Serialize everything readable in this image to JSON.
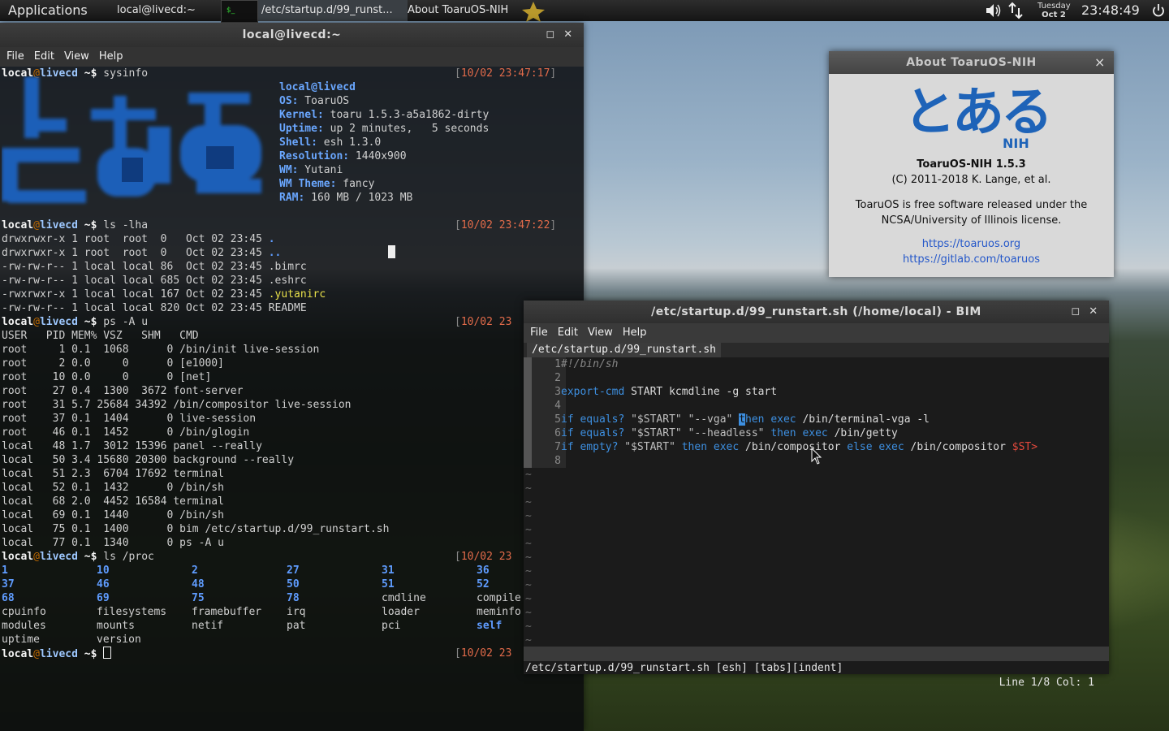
{
  "panel": {
    "apps": "Applications",
    "windows": [
      "local@livecd:~",
      "/etc/startup.d/99_runst...",
      "About ToaruOS-NIH"
    ],
    "thumb_text": "$_",
    "date_day": "Tuesday",
    "date_date": "Oct 2",
    "clock": "23:48:49",
    "volume_icon": "volume-icon",
    "network_icon": "network-icon",
    "power_icon": "power-icon"
  },
  "terminal": {
    "title": "local@livecd:~",
    "menu": [
      "File",
      "Edit",
      "View",
      "Help"
    ],
    "user": "local",
    "at": "@",
    "host": "livecd",
    "prompt": " ~$ ",
    "cmd1": "sysinfo",
    "ts1": "10/02 23:47:17",
    "sysinfo": [
      {
        "k": "",
        "v": "local@livecd"
      },
      {
        "k": "OS:",
        "v": " ToaruOS"
      },
      {
        "k": "Kernel:",
        "v": " toaru 1.5.3-a5a1862-dirty"
      },
      {
        "k": "Uptime:",
        "v": " up 2 minutes,   5 seconds"
      },
      {
        "k": "Shell:",
        "v": " esh 1.3.0"
      },
      {
        "k": "Resolution:",
        "v": " 1440x900"
      },
      {
        "k": "WM:",
        "v": " Yutani"
      },
      {
        "k": "WM Theme:",
        "v": " fancy"
      },
      {
        "k": "RAM:",
        "v": " 160 MB / 1023 MB"
      }
    ],
    "cmd2": "ls -lha",
    "ts2": "10/02 23:47:22",
    "ls_rows": [
      {
        "p": "drwxrwxr-x 1 root  root  0   Oct 02 23:45 ",
        "n": ".",
        "c": "bl"
      },
      {
        "p": "drwxrwxr-x 1 root  root  0   Oct 02 23:45 ",
        "n": "..",
        "c": "bl"
      },
      {
        "p": "-rw-rw-r-- 1 local local 86  Oct 02 23:45 ",
        "n": ".bimrc",
        "c": ""
      },
      {
        "p": "-rw-rw-r-- 1 local local 685 Oct 02 23:45 ",
        "n": ".eshrc",
        "c": ""
      },
      {
        "p": "-rwxrwxr-x 1 local local 167 Oct 02 23:45 ",
        "n": ".yutanirc",
        "c": "yl"
      },
      {
        "p": "-rw-rw-r-- 1 local local 820 Oct 02 23:45 ",
        "n": "README",
        "c": ""
      }
    ],
    "cmd3": "ps -A u",
    "ts3": "10/02 23",
    "ps_rows": [
      "USER   PID MEM% VSZ   SHM   CMD",
      "root     1 0.1  1068      0 /bin/init live-session",
      "root     2 0.0     0      0 [e1000]",
      "root    10 0.0     0      0 [net]",
      "root    27 0.4  1300  3672 font-server",
      "root    31 5.7 25684 34392 /bin/compositor live-session",
      "root    37 0.1  1404      0 live-session",
      "root    46 0.1  1452      0 /bin/glogin",
      "local   48 1.7  3012 15396 panel --really",
      "local   50 3.4 15680 20300 background --really",
      "local   51 2.3  6704 17692 terminal",
      "local   52 0.1  1432      0 /bin/sh",
      "local   68 2.0  4452 16584 terminal",
      "local   69 0.1  1440      0 /bin/sh",
      "local   75 0.1  1400      0 bim /etc/startup.d/99_runstart.sh",
      "local   77 0.1  1340      0 ps -A u"
    ],
    "cmd4": "ls /proc",
    "ts4": "10/02 23",
    "proc_rows": [
      [
        "1",
        "10",
        "2",
        "27",
        "31",
        "36"
      ],
      [
        "37",
        "46",
        "48",
        "50",
        "51",
        "52"
      ],
      [
        "68",
        "69",
        "75",
        "78",
        "cmdline",
        "compile"
      ],
      [
        "cpuinfo",
        "filesystems",
        "framebuffer",
        "irq",
        "loader",
        "meminfo"
      ],
      [
        "modules",
        "mounts",
        "netif",
        "pat",
        "pci",
        "self"
      ],
      [
        "uptime",
        "version",
        "",
        "",
        "",
        ""
      ]
    ],
    "ts5": "10/02 23"
  },
  "about": {
    "title": "About ToaruOS-NIH",
    "logo_text": "とある",
    "logo_sub": "NIH",
    "name": "ToaruOS-NIH 1.5.3",
    "copyright": "(C) 2011-2018 K. Lange, et al.",
    "desc1": "ToaruOS is free software released under the",
    "desc2": "NCSA/University of Illinois license.",
    "link1": "https://toaruos.org",
    "link2": "https://gitlab.com/toaruos",
    "close_icon": "×"
  },
  "bim": {
    "title": "/etc/startup.d/99_runstart.sh (/home/local) - BIM",
    "menu": [
      "File",
      "Edit",
      "View",
      "Help"
    ],
    "tab": "/etc/startup.d/99_runstart.sh",
    "line_numbers": [
      "1",
      "2",
      "3",
      "4",
      "5",
      "6",
      "7",
      "8"
    ],
    "status_left": "/etc/startup.d/99_runstart.sh [esh] [tabs][indent]",
    "status_right": "Line 1/8 Col: 1",
    "code": {
      "l1": "#!/bin/sh",
      "l3a": "export-cmd",
      "l3b": " START kcmdline -g start",
      "l5": [
        "if",
        " equals? ",
        "\"$START\"",
        " ",
        "\"--vga\"",
        " ",
        "t",
        "hen",
        " exec",
        " /bin/terminal-vga -l"
      ],
      "l6": [
        "if",
        " equals? ",
        "\"$START\"",
        " ",
        "\"--headless\"",
        " ",
        "then",
        " exec",
        " /bin/getty"
      ],
      "l7": [
        "if",
        " empty? ",
        "\"$START\"",
        " ",
        "then",
        " exec",
        " /bin/compositor ",
        "else",
        " exec",
        " /bin/compositor ",
        "$ST>"
      ]
    }
  }
}
